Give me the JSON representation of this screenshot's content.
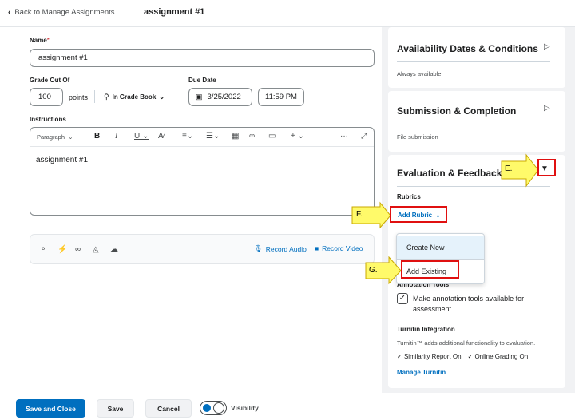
{
  "header": {
    "back_label": "Back to Manage Assignments",
    "title": "assignment #1"
  },
  "form": {
    "name_label": "Name",
    "name_required_mark": "*",
    "name_value": "assignment #1",
    "grade_label": "Grade Out Of",
    "grade_value": "100",
    "points_label": "points",
    "gradebook_label": "In Grade Book",
    "due_label": "Due Date",
    "due_date": "3/25/2022",
    "due_time": "11:59 PM",
    "instructions_label": "Instructions",
    "editor_paragraph": "Paragraph",
    "editor_content": "assignment #1",
    "record_audio": "Record Audio",
    "record_video": "Record Video"
  },
  "right": {
    "availability_title": "Availability Dates & Conditions",
    "availability_sub": "Always available",
    "submission_title": "Submission & Completion",
    "submission_sub": "File submission",
    "evaluation_title": "Evaluation & Feedback",
    "rubrics_label": "Rubrics",
    "add_rubric": "Add Rubric",
    "annotation_label": "Annotation Tools",
    "annotation_checkbox": "Make annotation tools available for assessment",
    "turnitin_label": "Turnitin Integration",
    "turnitin_desc": "Turnitin™ adds additional functionality to evaluation.",
    "similarity": "Similarity Report On",
    "online_grading": "Online Grading On",
    "manage_turnitin": "Manage Turnitin"
  },
  "dropdown": {
    "items": [
      "Create New",
      "Add Existing"
    ]
  },
  "callouts": {
    "e": "E.",
    "f": "F.",
    "g": "G."
  },
  "footer": {
    "save_close": "Save and Close",
    "save": "Save",
    "cancel": "Cancel",
    "visibility": "Visibility"
  },
  "colors": {
    "primary": "#006fbf",
    "callout_yellow": "#fffa6a",
    "highlight_red": "#e01010"
  }
}
